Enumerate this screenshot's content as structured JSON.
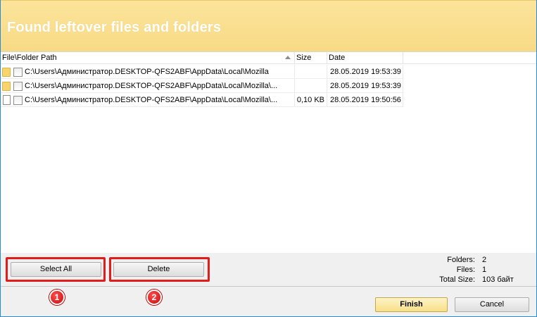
{
  "header": {
    "title": "Found leftover files and folders"
  },
  "list": {
    "columns": {
      "path": "File\\Folder Path",
      "size": "Size",
      "date": "Date"
    },
    "rows": [
      {
        "type": "folder",
        "path": "C:\\Users\\Администратор.DESKTOP-QFS2ABF\\AppData\\Local\\Mozilla",
        "size": "",
        "date": "28.05.2019 19:53:39"
      },
      {
        "type": "folder",
        "path": "C:\\Users\\Администратор.DESKTOP-QFS2ABF\\AppData\\Local\\Mozilla\\...",
        "size": "",
        "date": "28.05.2019 19:53:39"
      },
      {
        "type": "file",
        "path": "C:\\Users\\Администратор.DESKTOP-QFS2ABF\\AppData\\Local\\Mozilla\\...",
        "size": "0,10 KB",
        "date": "28.05.2019 19:50:56"
      }
    ]
  },
  "actions": {
    "select_all": "Select All",
    "delete": "Delete",
    "finish": "Finish",
    "cancel": "Cancel"
  },
  "badges": {
    "one": "1",
    "two": "2"
  },
  "stats": {
    "folders_label": "Folders:",
    "folders_value": "2",
    "files_label": "Files:",
    "files_value": "1",
    "total_label": "Total Size:",
    "total_value": "103 байт"
  },
  "colors": {
    "header_bg": "#f8da85",
    "highlight": "#e21b1b",
    "finish_bg": "#f7df86"
  }
}
